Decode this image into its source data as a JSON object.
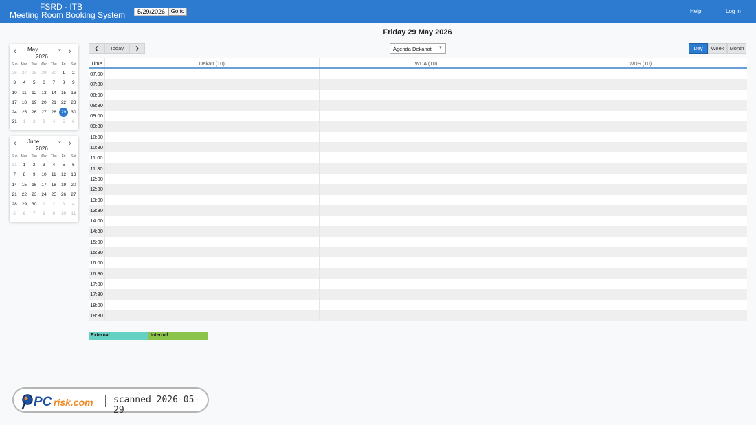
{
  "header": {
    "brand_line1": "FSRD - ITB",
    "brand_line2": "Meeting Room Booking System",
    "goto_value": "5/29/2026",
    "goto_label": "Go to",
    "help_label": "Help",
    "login_label": "Log in"
  },
  "title": "Friday 29 May 2026",
  "mini_calendars": [
    {
      "month": "May",
      "year": "2026",
      "dow": [
        "Sun",
        "Mon",
        "Tue",
        "Wed",
        "Thu",
        "Fri",
        "Sat"
      ],
      "days": [
        {
          "d": "26",
          "o": true
        },
        {
          "d": "27",
          "o": true
        },
        {
          "d": "28",
          "o": true
        },
        {
          "d": "29",
          "o": true
        },
        {
          "d": "30",
          "o": true
        },
        {
          "d": "1"
        },
        {
          "d": "2"
        },
        {
          "d": "3"
        },
        {
          "d": "4"
        },
        {
          "d": "5"
        },
        {
          "d": "6"
        },
        {
          "d": "7"
        },
        {
          "d": "8"
        },
        {
          "d": "9"
        },
        {
          "d": "10"
        },
        {
          "d": "11"
        },
        {
          "d": "12"
        },
        {
          "d": "13"
        },
        {
          "d": "14"
        },
        {
          "d": "15"
        },
        {
          "d": "16"
        },
        {
          "d": "17"
        },
        {
          "d": "18"
        },
        {
          "d": "19"
        },
        {
          "d": "20"
        },
        {
          "d": "21"
        },
        {
          "d": "22"
        },
        {
          "d": "23"
        },
        {
          "d": "24"
        },
        {
          "d": "25"
        },
        {
          "d": "26"
        },
        {
          "d": "27"
        },
        {
          "d": "28"
        },
        {
          "d": "29",
          "s": true
        },
        {
          "d": "30"
        },
        {
          "d": "31"
        },
        {
          "d": "1",
          "o": true
        },
        {
          "d": "2",
          "o": true
        },
        {
          "d": "3",
          "o": true
        },
        {
          "d": "4",
          "o": true
        },
        {
          "d": "5",
          "o": true
        },
        {
          "d": "6",
          "o": true
        }
      ]
    },
    {
      "month": "June",
      "year": "2026",
      "dow": [
        "Sun",
        "Mon",
        "Tue",
        "Wed",
        "Thu",
        "Fri",
        "Sat"
      ],
      "days": [
        {
          "d": "31",
          "o": true
        },
        {
          "d": "1"
        },
        {
          "d": "2"
        },
        {
          "d": "3"
        },
        {
          "d": "4"
        },
        {
          "d": "5"
        },
        {
          "d": "6"
        },
        {
          "d": "7"
        },
        {
          "d": "8"
        },
        {
          "d": "9"
        },
        {
          "d": "10"
        },
        {
          "d": "11"
        },
        {
          "d": "12"
        },
        {
          "d": "13"
        },
        {
          "d": "14"
        },
        {
          "d": "15"
        },
        {
          "d": "16"
        },
        {
          "d": "17"
        },
        {
          "d": "18"
        },
        {
          "d": "19"
        },
        {
          "d": "20"
        },
        {
          "d": "21"
        },
        {
          "d": "22"
        },
        {
          "d": "23"
        },
        {
          "d": "24"
        },
        {
          "d": "25"
        },
        {
          "d": "26"
        },
        {
          "d": "27"
        },
        {
          "d": "28"
        },
        {
          "d": "29"
        },
        {
          "d": "30"
        },
        {
          "d": "1",
          "o": true
        },
        {
          "d": "2",
          "o": true
        },
        {
          "d": "3",
          "o": true
        },
        {
          "d": "4",
          "o": true
        },
        {
          "d": "5",
          "o": true
        },
        {
          "d": "6",
          "o": true
        },
        {
          "d": "7",
          "o": true
        },
        {
          "d": "8",
          "o": true
        },
        {
          "d": "9",
          "o": true
        },
        {
          "d": "10",
          "o": true
        },
        {
          "d": "11",
          "o": true
        }
      ]
    }
  ],
  "toolbar": {
    "prev_label": "❮",
    "today_label": "Today",
    "next_label": "❯",
    "area_selected": "Agenda Dekanat",
    "view_day": "Day",
    "view_week": "Week",
    "view_month": "Month"
  },
  "schedule": {
    "time_header": "Time",
    "rooms": [
      "Dekan (10)",
      "WDA (10)",
      "WDS (10)"
    ],
    "slots": [
      "07:00",
      "07:30",
      "08:00",
      "08:30",
      "09:00",
      "09:30",
      "10:00",
      "10:30",
      "11:00",
      "11:30",
      "12:00",
      "12:30",
      "13:00",
      "13:30",
      "14:00",
      "14:30",
      "15:00",
      "15:30",
      "16:00",
      "16:30",
      "17:00",
      "17:30",
      "18:00",
      "18:30"
    ]
  },
  "legend": {
    "external": "External",
    "internal": "Internal"
  },
  "watermark": {
    "logo_text": "PCrisk.com",
    "scan_text": "scanned 2026-05-29"
  },
  "colors": {
    "header_bg": "#2d7bd1",
    "selected_day": "#2d7bd1",
    "external": "#66d1c3",
    "internal": "#8bc34a"
  }
}
